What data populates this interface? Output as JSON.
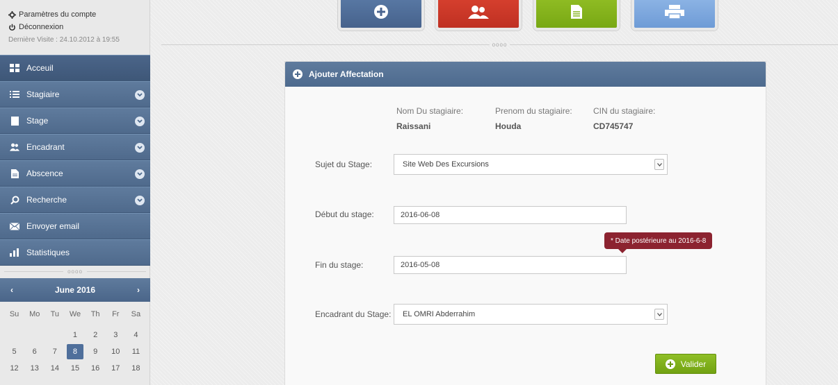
{
  "account": {
    "settings_label": "Paramètres du compte",
    "logout_label": "Déconnexion",
    "last_visit": "Dernière Visite : 24.10.2012 à 19:55"
  },
  "nav": {
    "items": [
      {
        "label": "Acceuil",
        "icon": "grid-icon"
      },
      {
        "label": "Stagiaire",
        "icon": "list-icon"
      },
      {
        "label": "Stage",
        "icon": "document-icon"
      },
      {
        "label": "Encadrant",
        "icon": "users-icon"
      },
      {
        "label": "Abscence",
        "icon": "file-icon"
      },
      {
        "label": "Recherche",
        "icon": "search-icon"
      },
      {
        "label": "Envoyer email",
        "icon": "mail-icon"
      },
      {
        "label": "Statistiques",
        "icon": "bar-chart-icon"
      }
    ]
  },
  "divider": "oooo",
  "calendar": {
    "month": "June 2016",
    "prev": "‹",
    "next": "›",
    "weekdays": [
      "Su",
      "Mo",
      "Tu",
      "We",
      "Th",
      "Fr",
      "Sa"
    ],
    "days": [
      "",
      "",
      "",
      "1",
      "2",
      "3",
      "4",
      "5",
      "6",
      "7",
      "8",
      "9",
      "10",
      "11",
      "12",
      "13",
      "14",
      "15",
      "16",
      "17",
      "18"
    ],
    "selected": "8"
  },
  "panel": {
    "title": "Ajouter Affectation",
    "info": {
      "nom_label": "Nom Du stagiaire:",
      "nom_value": "Raissani",
      "prenom_label": "Prenom du stagiaire:",
      "prenom_value": "Houda",
      "cin_label": "CIN du stagiaire:",
      "cin_value": "CD745747"
    },
    "sujet_label": "Sujet du Stage:",
    "sujet_value": "Site Web Des Excursions",
    "debut_label": "Début du stage:",
    "debut_value": "2016-06-08",
    "tooltip": "* Date postérieure au 2016-6-8",
    "fin_label": "Fin du stage:",
    "fin_value": "2016-05-08",
    "encadrant_label": "Encadrant du Stage:",
    "encadrant_value": "EL OMRI Abderrahim",
    "submit_label": "Valider"
  },
  "colors": {
    "nav_blue": "#566f93",
    "add_button": "#4b6590",
    "users_button": "#c9372a",
    "doc_button": "#86b41e",
    "print_button": "#7ea7db",
    "error_tooltip": "#8c2330",
    "submit_green": "#7fb21b"
  }
}
